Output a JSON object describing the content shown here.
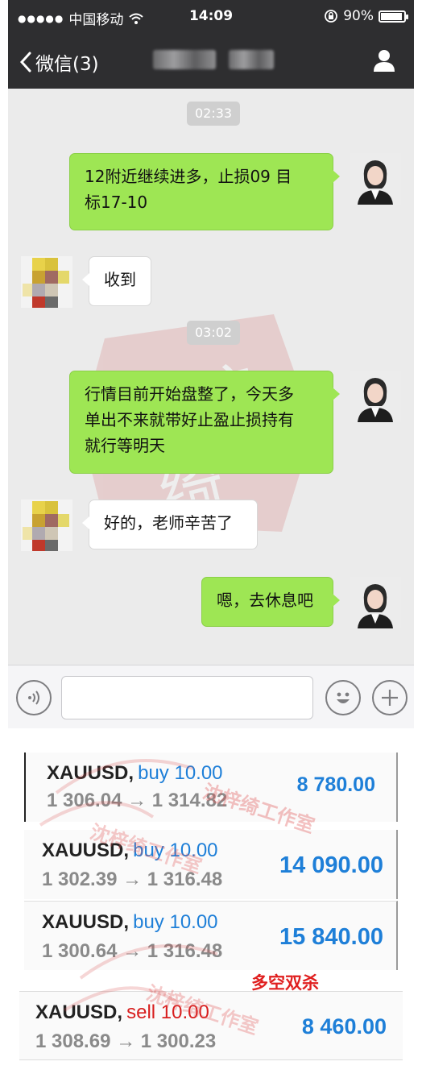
{
  "status_bar": {
    "signal": "●●●●●",
    "carrier": "中国移动",
    "time": "14:09",
    "battery": "90%"
  },
  "nav": {
    "back_label": "微信(3)"
  },
  "messages": [
    {
      "type": "time",
      "text": "02:33"
    },
    {
      "type": "out",
      "lines": [
        "12附近继续进多，止损09 目",
        "标17-10"
      ]
    },
    {
      "type": "in",
      "lines": [
        "收到"
      ]
    },
    {
      "type": "time",
      "text": "03:02"
    },
    {
      "type": "out",
      "lines": [
        "行情目前开始盘整了，今天多",
        "单出不来就带好止盈止损持有",
        "就行等明天"
      ]
    },
    {
      "type": "in",
      "lines": [
        "好的，老师辛苦了"
      ]
    },
    {
      "type": "out",
      "lines": [
        "嗯，去休息吧"
      ]
    }
  ],
  "trades": [
    {
      "symbol": "XAUUSD,",
      "side": "buy",
      "lots": "10.00",
      "side_label": "buy 10.00",
      "prices": "1 306.04 → 1 314.82",
      "profit": "8 780.00"
    },
    {
      "symbol": "XAUUSD,",
      "side": "buy",
      "lots": "10.00",
      "side_label": "buy 10.00",
      "prices": "1 302.39 → 1 316.48",
      "profit": "14 090.00"
    },
    {
      "symbol": "XAUUSD,",
      "side": "buy",
      "lots": "10.00",
      "side_label": "buy 10.00",
      "prices": "1 300.64 → 1 316.48",
      "profit": "15 840.00"
    },
    {
      "symbol": "XAUUSD,",
      "side": "sell",
      "lots": "10.00",
      "side_label": "sell 10.00",
      "prices": "1 308.69 → 1 300.23",
      "profit": "8 460.00"
    }
  ],
  "annotation": "多空双杀",
  "watermark_text": "沈梓绮工作室",
  "icons": {
    "wifi": "wifi-icon",
    "lock": "rotation-lock-icon",
    "back": "chevron-left-icon",
    "profile": "person-icon",
    "voice": "voice-icon",
    "emoji": "emoji-icon",
    "plus": "plus-icon"
  },
  "colors": {
    "outgoing_bubble": "#9ee654",
    "incoming_bubble": "#ffffff",
    "chat_background": "#ebebeb",
    "header": "#2e2e30",
    "profit": "#1e7fd8",
    "sell": "#d81e1e",
    "annotation": "#e02020"
  }
}
